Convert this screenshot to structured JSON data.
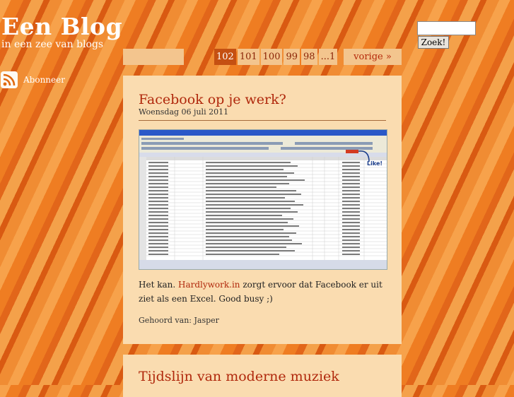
{
  "header": {
    "title": "Een Blog",
    "tagline": "in een zee van blogs"
  },
  "subscribe": {
    "label": "Abonneer",
    "icon": "rss-icon"
  },
  "search": {
    "value": "",
    "button_label": "Zoek!"
  },
  "pagination": {
    "pages": [
      "102",
      "101",
      "100",
      "99",
      "98",
      "...1"
    ],
    "current": "102",
    "next_label": "vorige »"
  },
  "posts": [
    {
      "title": "Facebook op je werk?",
      "date": "Woensdag 06 juli 2011",
      "body_before": "Het kan. ",
      "link_text": "Hardlywork.in",
      "body_after": " zorgt ervoor dat Facebook er uit ziet als een Excel. Good busy ;)",
      "author": "Gehoord van: Jasper",
      "image_callout": "Like!"
    },
    {
      "title": "Tijdslijn van moderne muziek"
    }
  ],
  "colors": {
    "accent": "#b0280c",
    "post_bg": "#fadcb0",
    "pager_current": "#c55012"
  }
}
